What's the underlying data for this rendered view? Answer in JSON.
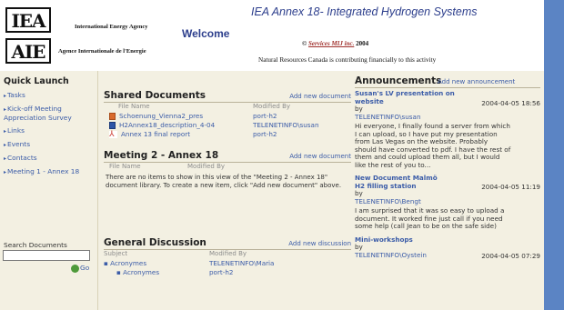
{
  "header": {
    "logo_top": "IEA",
    "logo_bottom": "AIE",
    "org_english": "International Energy Agency",
    "org_french": "Agence Internationale de l'Energie",
    "welcome": "Welcome",
    "title": "IEA Annex 18- Integrated Hydrogen Systems",
    "copyright_prefix": "©",
    "copyright_link": "Services MIJ inc.",
    "copyright_year": "2004",
    "sponsor_note": "Natural Resources Canada is contributing financially to this activity"
  },
  "quick_launch": {
    "title": "Quick Launch",
    "items": [
      "Tasks",
      "Kick-off Meeting Appreciation Survey",
      "Links",
      "Events",
      "Contacts",
      "Meeting 1 - Annex 18"
    ]
  },
  "search": {
    "label": "Search Documents",
    "value": "",
    "go_label": "Go"
  },
  "shared_documents": {
    "title": "Shared Documents",
    "add_link": "Add new document",
    "col_name": "File Name",
    "col_modified": "Modified By",
    "rows": [
      {
        "name": "Schoenung_Vienna2_pres",
        "modified": "port-h2",
        "icon": "ppt-file-icon"
      },
      {
        "name": "H2Annex18_description_4-04",
        "modified": "TELENETINFO\\susan",
        "icon": "word-file-icon"
      },
      {
        "name": "Annex 13 final report",
        "modified": "port-h2",
        "icon": "pdf-file-icon"
      }
    ]
  },
  "meeting2": {
    "title": "Meeting 2 - Annex 18",
    "add_link": "Add new document",
    "col_name": "File Name",
    "col_modified": "Modified By",
    "empty_message": "There are no items to show in this view of the \"Meeting 2 - Annex 18\" document library. To create a new item, click \"Add new document\" above."
  },
  "discussion": {
    "title": "General Discussion",
    "add_link": "Add new discussion",
    "col_subject": "Subject",
    "col_modified": "Modified By",
    "rows": [
      {
        "subject": "Acronymes",
        "modified": "TELENETINFO\\Maria"
      },
      {
        "subject": "Acronymes",
        "modified": "port-h2"
      }
    ]
  },
  "announcements": {
    "title": "Announcements",
    "add_link": "Add new announcement",
    "items": [
      {
        "subject": "Susan's LV presentation on website",
        "date": "2004-04-05 18:56",
        "by": "by",
        "author": "TELENETINFO\\susan",
        "body": "Hi everyone, I finally found a server from which I can upload, so I have put my presentation from Las Vegas on the website. Probably should have converted to pdf. I have the rest of them and could upload them all, but I would like the rest of you to..."
      },
      {
        "subject": "New Document Malmö H2 filling station",
        "date": "2004-04-05 11:19",
        "by": "by",
        "author": "TELENETINFO\\Bengt",
        "body": "I am surprised that it was so easy to upload a document. It worked fine just call if you need some help (call Jean to be on the safe side)"
      },
      {
        "subject": "Mini-workshops",
        "date": "2004-04-05 07:29",
        "by": "by",
        "author": "TELENETINFO\\Oystein",
        "body": ""
      }
    ]
  },
  "colors": {
    "link": "#3b5ca8",
    "title_blue": "#2c3e8c",
    "panel_bg": "#f3f0e2",
    "right_bar": "#5b84c4"
  }
}
